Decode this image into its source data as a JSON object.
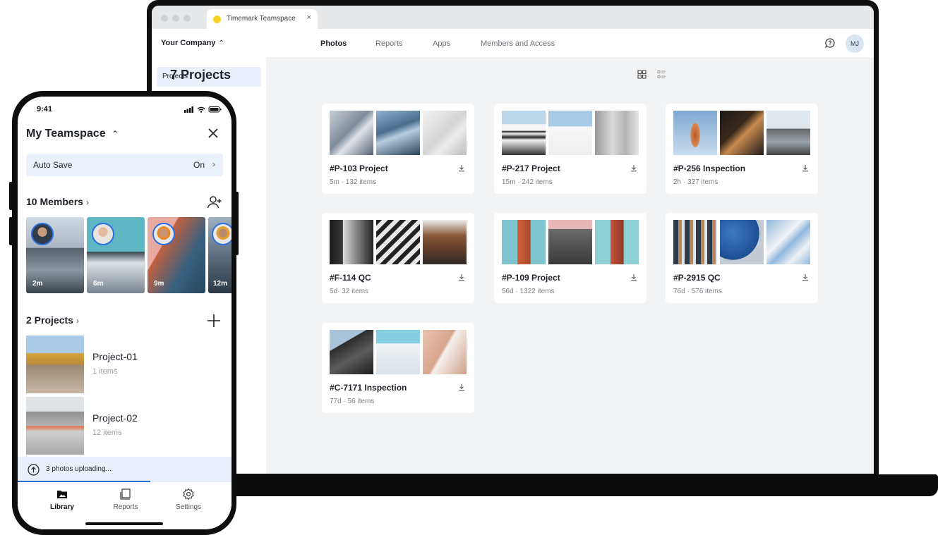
{
  "browser": {
    "tab_title": "Timemark Teamspace",
    "tab_close": "×"
  },
  "web": {
    "company": "Your Company",
    "nav": [
      "Photos",
      "Reports",
      "Apps",
      "Members and Access"
    ],
    "active_nav": "Photos",
    "user_initials": "MJ",
    "sidebar_items": [
      "Projects"
    ],
    "page_title": "7 Projects",
    "projects": [
      {
        "title": "#P-103 Project",
        "meta": "5m · 132 items"
      },
      {
        "title": "#P-217 Project",
        "meta": "15m · 242 items"
      },
      {
        "title": "#P-256 Inspection",
        "meta": "2h · 327 items"
      },
      {
        "title": "#F-114 QC",
        "meta": "5d· 32 items"
      },
      {
        "title": "#P-109 Project",
        "meta": "56d · 1322 items"
      },
      {
        "title": "#P-2915 QC",
        "meta": "76d · 576 items"
      },
      {
        "title": "#C-7171 Inspection",
        "meta": "77d · 56 items"
      }
    ]
  },
  "phone": {
    "time": "9:41",
    "teamspace": "My Teamspace",
    "auto_save_label": "Auto Save",
    "auto_save_value": "On",
    "members_title": "10 Members",
    "members": [
      {
        "time": "2m"
      },
      {
        "time": "6m"
      },
      {
        "time": "9m"
      },
      {
        "time": "12m"
      }
    ],
    "projects_title": "2 Projects",
    "projects": [
      {
        "name": "Project-01",
        "count": "1 items"
      },
      {
        "name": "Project-02",
        "count": "12 items"
      }
    ],
    "upload_text": "3 photos uploading...",
    "upload_progress": 0.62,
    "tabs": [
      "Library",
      "Reports",
      "Settings"
    ],
    "active_tab": "Library"
  },
  "colors": {
    "accent": "#2b6fe0",
    "highlight_bg": "#e9f0fb",
    "content_bg": "#f2f3f5"
  }
}
